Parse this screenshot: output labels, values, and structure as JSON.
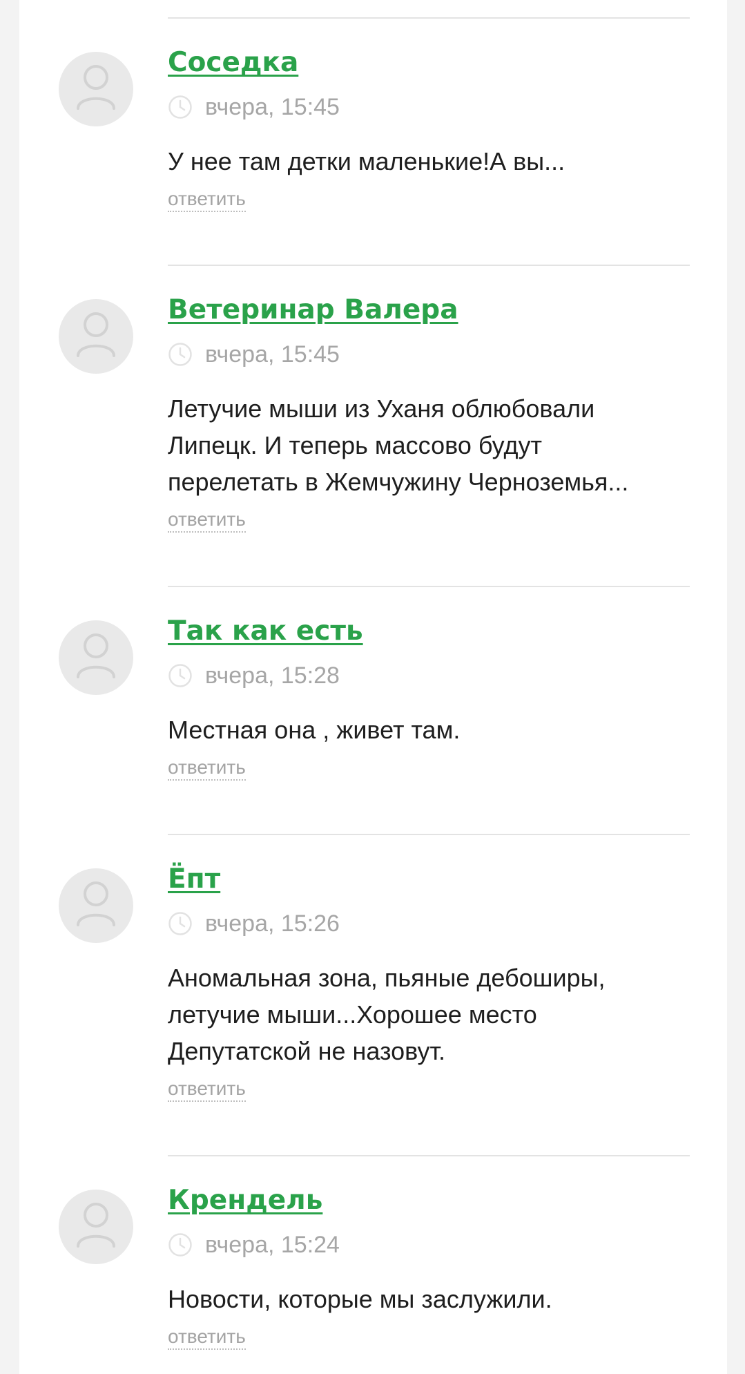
{
  "comments": [
    {
      "author": "Соседка",
      "time": "вчера, 15:45",
      "text": "У нее там детки маленькие!А вы...",
      "reply": "ответить"
    },
    {
      "author": "Ветеринар Валера",
      "time": "вчера, 15:45",
      "text": "Летучие мыши из Уханя облюбовали\nЛипецк. И теперь массово будут\nперелетать в Жемчужину Черноземья...",
      "reply": "ответить"
    },
    {
      "author": "Так как есть",
      "time": "вчера, 15:28",
      "text": "Местная она , живет там.",
      "reply": "ответить"
    },
    {
      "author": "Ёпт",
      "time": "вчера, 15:26",
      "text": "Аномальная зона, пьяные дебоширы,\nлетучие мыши...Хорошее место\nДепутатской не назовут.",
      "reply": "ответить"
    },
    {
      "author": "Крендель",
      "time": "вчера, 15:24",
      "text": "Новости, которые мы заслужили.",
      "reply": "ответить"
    }
  ],
  "icons": {
    "avatar": "user-placeholder-icon",
    "time": "clock-icon"
  },
  "colors": {
    "author_link": "#2aa24a",
    "meta": "#a6a6a6",
    "text": "#1e1e1e",
    "avatar_bg": "#e9e9e9",
    "page_bg": "#f3f3f3"
  }
}
